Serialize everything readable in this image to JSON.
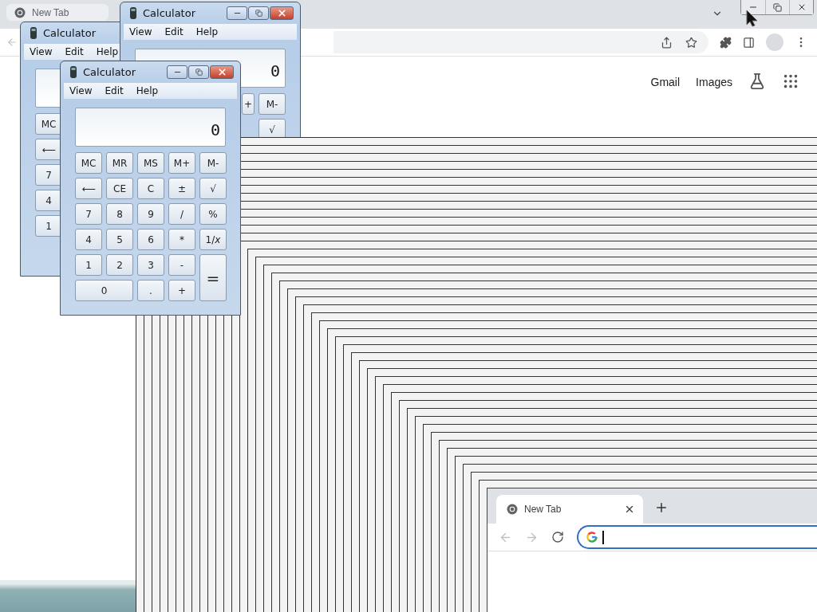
{
  "browser": {
    "tab": {
      "title": "New Tab",
      "selected": true
    },
    "header_links": [
      "Gmail",
      "Images"
    ]
  },
  "calculators": [
    {
      "kind": "clipped-right",
      "title": "Calculator",
      "menu": [
        "View",
        "Edit",
        "Help"
      ],
      "keys": [
        [
          {
            "label": "MC",
            "kind": "normal"
          }
        ],
        [
          {
            "label": "⟵",
            "kind": "normal"
          }
        ],
        [
          {
            "label": "7",
            "kind": "normal"
          }
        ],
        [
          {
            "label": "4",
            "kind": "normal"
          }
        ],
        [
          {
            "label": "1",
            "kind": "normal"
          }
        ]
      ]
    },
    {
      "kind": "clipped-left",
      "title": "Calculator",
      "menu": [
        "View",
        "Edit",
        "Help"
      ],
      "display": "0",
      "keys": [
        [
          {
            "label": "+",
            "kind": "normal"
          },
          {
            "label": "M-",
            "kind": "normal"
          }
        ],
        [
          {
            "label": "√",
            "kind": "normal"
          }
        ]
      ]
    },
    {
      "kind": "full",
      "title": "Calculator",
      "menu": [
        "View",
        "Edit",
        "Help"
      ],
      "display": "0",
      "keys": [
        [
          {
            "label": "MC",
            "kind": "normal"
          },
          {
            "label": "MR",
            "kind": "normal"
          },
          {
            "label": "MS",
            "kind": "normal"
          },
          {
            "label": "M+",
            "kind": "normal"
          },
          {
            "label": "M-",
            "kind": "normal"
          }
        ],
        [
          {
            "label": "⟵",
            "kind": "normal"
          },
          {
            "label": "CE",
            "kind": "normal"
          },
          {
            "label": "C",
            "kind": "normal"
          },
          {
            "label": "±",
            "kind": "normal"
          },
          {
            "label": "√",
            "kind": "normal"
          }
        ],
        [
          {
            "label": "7",
            "kind": "normal"
          },
          {
            "label": "8",
            "kind": "normal"
          },
          {
            "label": "9",
            "kind": "normal"
          },
          {
            "label": "/",
            "kind": "normal"
          },
          {
            "label": "%",
            "kind": "normal"
          }
        ],
        [
          {
            "label": "4",
            "kind": "normal"
          },
          {
            "label": "5",
            "kind": "normal"
          },
          {
            "label": "6",
            "kind": "normal"
          },
          {
            "label": "*",
            "kind": "normal"
          },
          {
            "label": "1/*x*",
            "kind": "normal"
          }
        ],
        [
          {
            "label": "1",
            "kind": "normal"
          },
          {
            "label": "2",
            "kind": "normal"
          },
          {
            "label": "3",
            "kind": "normal"
          },
          {
            "label": "-",
            "kind": "normal"
          },
          {
            "label": "=",
            "kind": "tall"
          }
        ],
        [
          {
            "label": "0",
            "kind": "wide"
          },
          {
            "label": ".",
            "kind": "normal"
          },
          {
            "label": "+",
            "kind": "normal"
          }
        ]
      ]
    }
  ],
  "new_window": {
    "tab": {
      "title": "New Tab",
      "selected": true
    },
    "back": {
      "disabled": true
    },
    "forward": {
      "disabled": true
    }
  }
}
